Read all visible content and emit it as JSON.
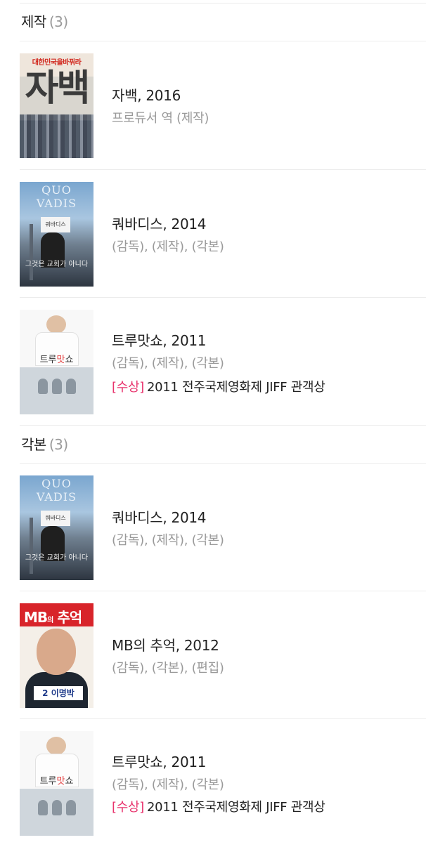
{
  "sections": [
    {
      "title": "제작",
      "count": "(3)",
      "items": [
        {
          "title": "자백, 2016",
          "roles": "프로듀서 역 (제작)"
        },
        {
          "title": "쿼바디스, 2014",
          "roles": "(감독), (제작), (각본)"
        },
        {
          "title": "트루맛쇼, 2011",
          "roles": "(감독), (제작), (각본)",
          "award_tag": "[수상]",
          "award_text": "2011 전주국제영화제 JIFF 관객상"
        }
      ]
    },
    {
      "title": "각본",
      "count": "(3)",
      "items": [
        {
          "title": "쿼바디스, 2014",
          "roles": "(감독), (제작), (각본)"
        },
        {
          "title": "MB의 추억, 2012",
          "roles": "(감독), (각본), (편집)"
        },
        {
          "title": "트루맛쇼, 2011",
          "roles": "(감독), (제작), (각본)",
          "award_tag": "[수상]",
          "award_text": "2011 전주국제영화제 JIFF 관객상"
        }
      ]
    }
  ],
  "posters": {
    "jabaek": {
      "top": "대한민국을바꿔라",
      "big": "자백"
    },
    "quo": {
      "top": "QUO VADIS",
      "sign": "쿼바디스",
      "bottom": "그것은 교회가 아니다"
    },
    "true": {
      "label_a": "트루",
      "label_b": "맛",
      "label_c": "쇼"
    },
    "mb": {
      "title": "MB",
      "title_small": "의",
      "title_b": "추억",
      "name": "2 이명박"
    }
  },
  "colors": {
    "award": "#e8336d",
    "muted": "#9a9a9a",
    "divider": "#ececec"
  }
}
